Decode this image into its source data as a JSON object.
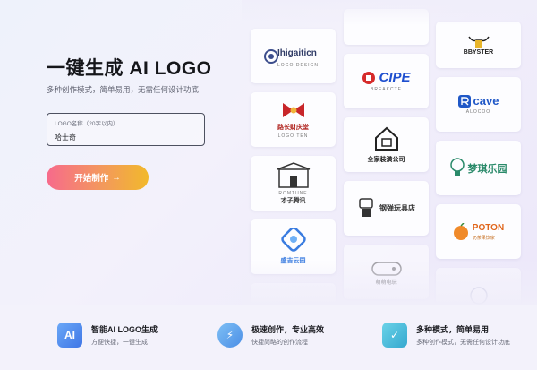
{
  "hero": {
    "title": "一键生成 AI LOGO",
    "subtitle": "多种创作模式，简单易用，无需任何设计功底",
    "name_label": "LOGO名称（20字以内）",
    "name_value": "哈士奇",
    "start_button": "开始制作",
    "start_arrow": "→"
  },
  "gallery": {
    "col1": [
      {
        "text": "Ihigaiticn",
        "sub": "LOGO DESIGN",
        "icon": "circle-knot-icon",
        "color": "#2f3b66"
      },
      {
        "text": "路长财庆堂",
        "sub": "LOGO TEN",
        "icon": "red-bow-icon",
        "color": "#b0221d"
      },
      {
        "text": "才子腾讯",
        "sub": "ROMTUNE",
        "icon": "gate-icon",
        "color": "#333"
      },
      {
        "text": "盛吉云园",
        "sub": "",
        "icon": "cloud-square-icon",
        "color": "#3a7ce0"
      },
      {
        "text": "",
        "sub": "",
        "icon": "",
        "color": "#999"
      }
    ],
    "col2": [
      {
        "text": "",
        "sub": "",
        "icon": "",
        "color": "#999"
      },
      {
        "text": "CIPE",
        "sub": "BREAKCTE",
        "icon": "gear-badge-icon",
        "color": "#1e4fcf"
      },
      {
        "text": "全家装潢公司",
        "sub": "",
        "icon": "house-icon",
        "color": "#222"
      },
      {
        "text": "钢弹玩具店",
        "sub": "",
        "icon": "robot-icon",
        "color": "#333"
      },
      {
        "text": "萌萌电玩",
        "sub": "",
        "icon": "gamepad-icon",
        "color": "#555"
      }
    ],
    "col3": [
      {
        "text": "BBYSTER",
        "sub": "",
        "icon": "ox-head-icon",
        "color": "#222"
      },
      {
        "text": "cave",
        "sub": "ALOCOO",
        "icon": "r-mark-icon",
        "color": "#2058c7"
      },
      {
        "text": "梦琪乐园",
        "sub": "",
        "icon": "bulb-icon",
        "color": "#2a8a6a"
      },
      {
        "text": "POTON",
        "sub": "奶茶果饮家",
        "icon": "orange-fruit-icon",
        "color": "#e0661c"
      },
      {
        "text": "",
        "sub": "",
        "icon": "round-face-icon",
        "color": "#9aa0c0"
      }
    ]
  },
  "features": [
    {
      "icon_text": "AI",
      "title": "智能AI LOGO生成",
      "desc": "方便快捷，一键生成",
      "color": "#4d8bf0",
      "icon": "ai-icon"
    },
    {
      "icon_text": "⚡",
      "title": "极速创作，专业高效",
      "desc": "快捷简略的创作流程",
      "color": "#5aa0e8",
      "icon": "lightning-icon"
    },
    {
      "icon_text": "✓",
      "title": "多种模式，简单易用",
      "desc": "多种创作模式，无需任何设计功底",
      "color": "#3fb7d4",
      "icon": "check-icon"
    }
  ]
}
